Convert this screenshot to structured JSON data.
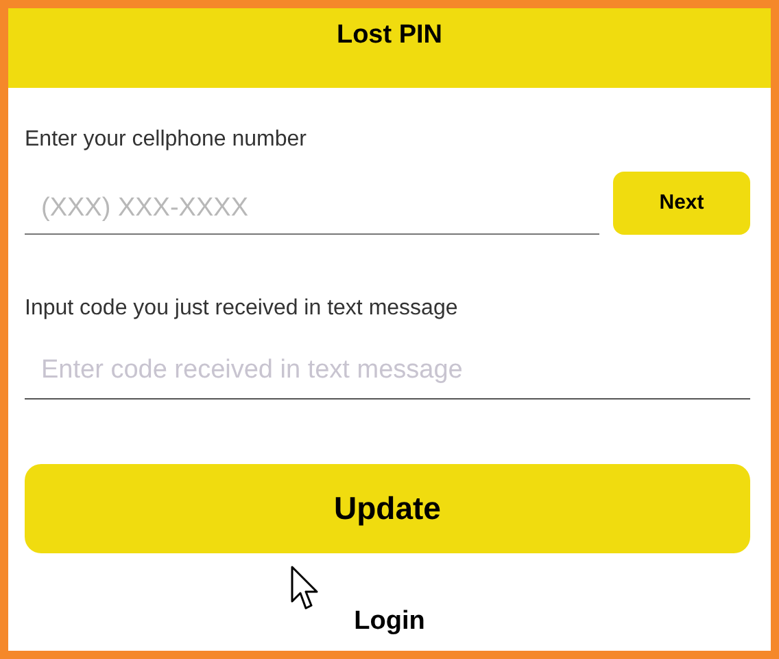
{
  "header": {
    "title": "Lost PIN"
  },
  "phone": {
    "label": "Enter your cellphone number",
    "placeholder": "(XXX) XXX-XXXX"
  },
  "next_button": "Next",
  "code": {
    "label": "Input code you just received in text message",
    "placeholder": "Enter code received in text message"
  },
  "update_button": "Update",
  "login_link": "Login"
}
